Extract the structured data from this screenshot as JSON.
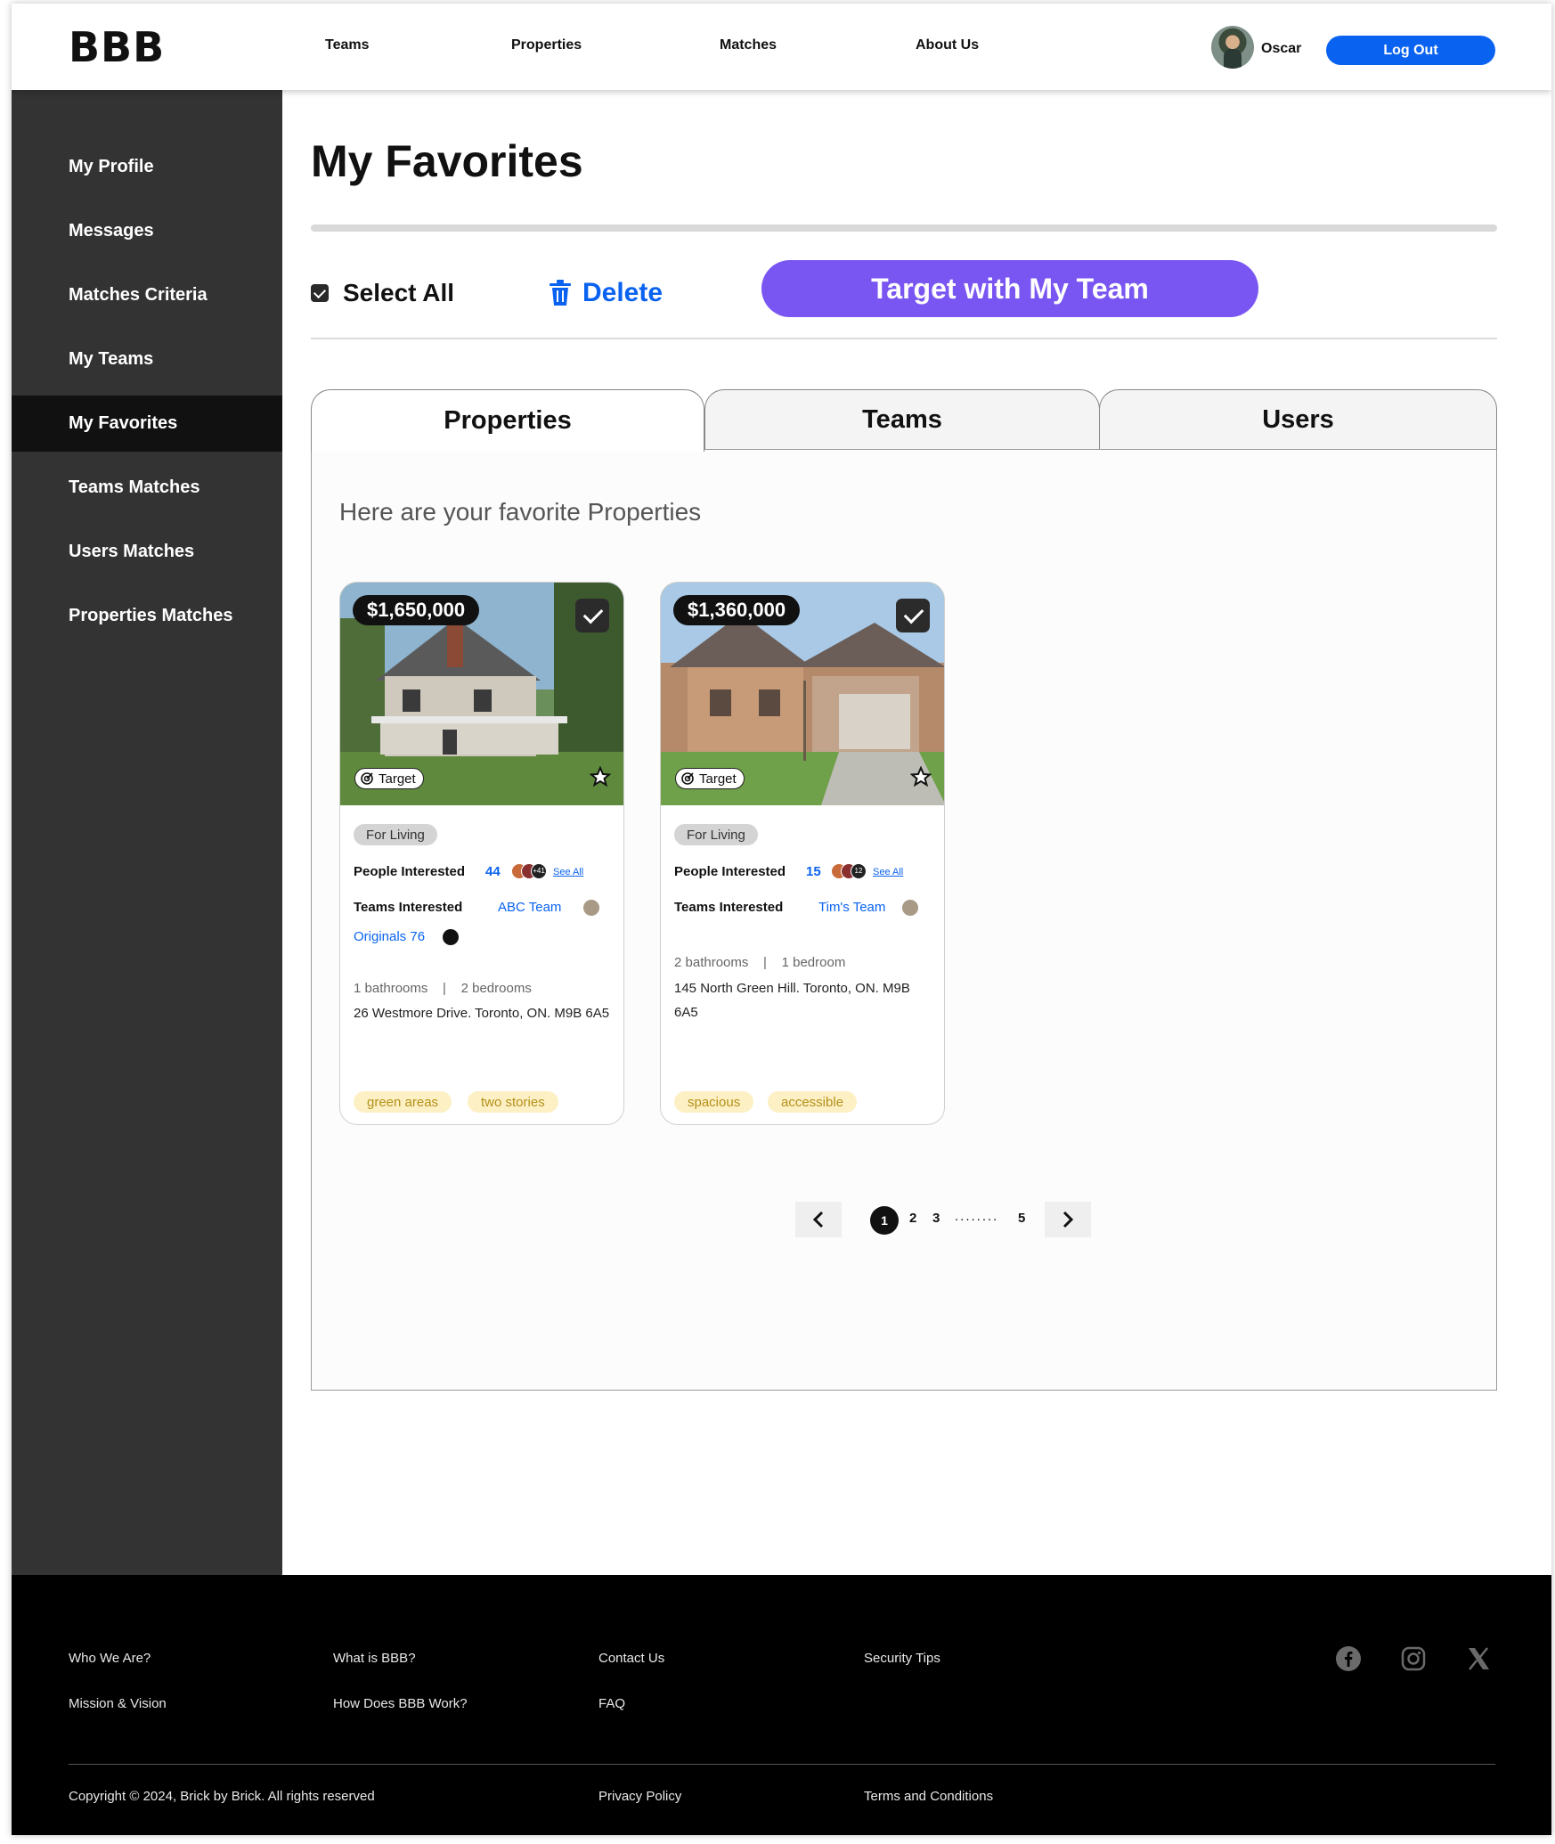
{
  "header": {
    "logo": "BBB",
    "nav": [
      "Teams",
      "Properties",
      "Matches",
      "About Us"
    ],
    "user_name": "Oscar",
    "logout_label": "Log Out"
  },
  "sidebar": {
    "items": [
      "My Profile",
      "Messages",
      "Matches Criteria",
      "My Teams",
      "My Favorites",
      "Teams Matches",
      "Users Matches",
      "Properties Matches"
    ],
    "active": "My Favorites"
  },
  "main": {
    "title": "My Favorites",
    "select_all_label": "Select All",
    "delete_label": "Delete",
    "target_button_label": "Target with My Team",
    "tabs": [
      "Properties",
      "Teams",
      "Users"
    ],
    "active_tab": "Properties",
    "subtitle": "Here are your favorite Properties"
  },
  "properties": [
    {
      "price": "$1,650,000",
      "target_label": "Target",
      "category": "For Living",
      "people_label": "People Interested",
      "people_count": "44",
      "avatar_more": "+41",
      "see_all": "See All",
      "teams_label": "Teams Interested",
      "teams": [
        "ABC Team",
        "Originals 76"
      ],
      "specs": "1 bathrooms    |    2 bedrooms",
      "address": "26 Westmore Drive. Toronto, ON. M9B 6A5",
      "tags": [
        "green areas",
        "two stories"
      ]
    },
    {
      "price": "$1,360,000",
      "target_label": "Target",
      "category": "For Living",
      "people_label": "People Interested",
      "people_count": "15",
      "avatar_more": "12",
      "see_all": "See All",
      "teams_label": "Teams Interested",
      "teams": [
        "Tim's Team"
      ],
      "specs": "2 bathrooms    |    1 bedroom",
      "address": "145 North Green Hill. Toronto, ON. M9B 6A5",
      "tags": [
        "spacious",
        "accessible"
      ]
    }
  ],
  "pagination": {
    "current": "1",
    "pages": [
      "2",
      "3",
      "5"
    ],
    "dots": "........"
  },
  "footer": {
    "links_col1": [
      "Who We Are?",
      "Mission & Vision"
    ],
    "links_col2": [
      "What is BBB?",
      "How Does BBB Work?"
    ],
    "links_col3": [
      "Contact Us",
      "FAQ"
    ],
    "links_col4": [
      "Security Tips"
    ],
    "copyright": "Copyright © 2024, Brick by Brick. All rights reserved",
    "privacy": "Privacy Policy",
    "terms": "Terms and Conditions",
    "social_icons": [
      "facebook-icon",
      "instagram-icon",
      "x-icon"
    ]
  },
  "colors": {
    "accent_blue": "#0a63f0",
    "accent_purple": "#7956f2",
    "sidebar": "#333333",
    "tag_bg": "#fdf0c5"
  }
}
